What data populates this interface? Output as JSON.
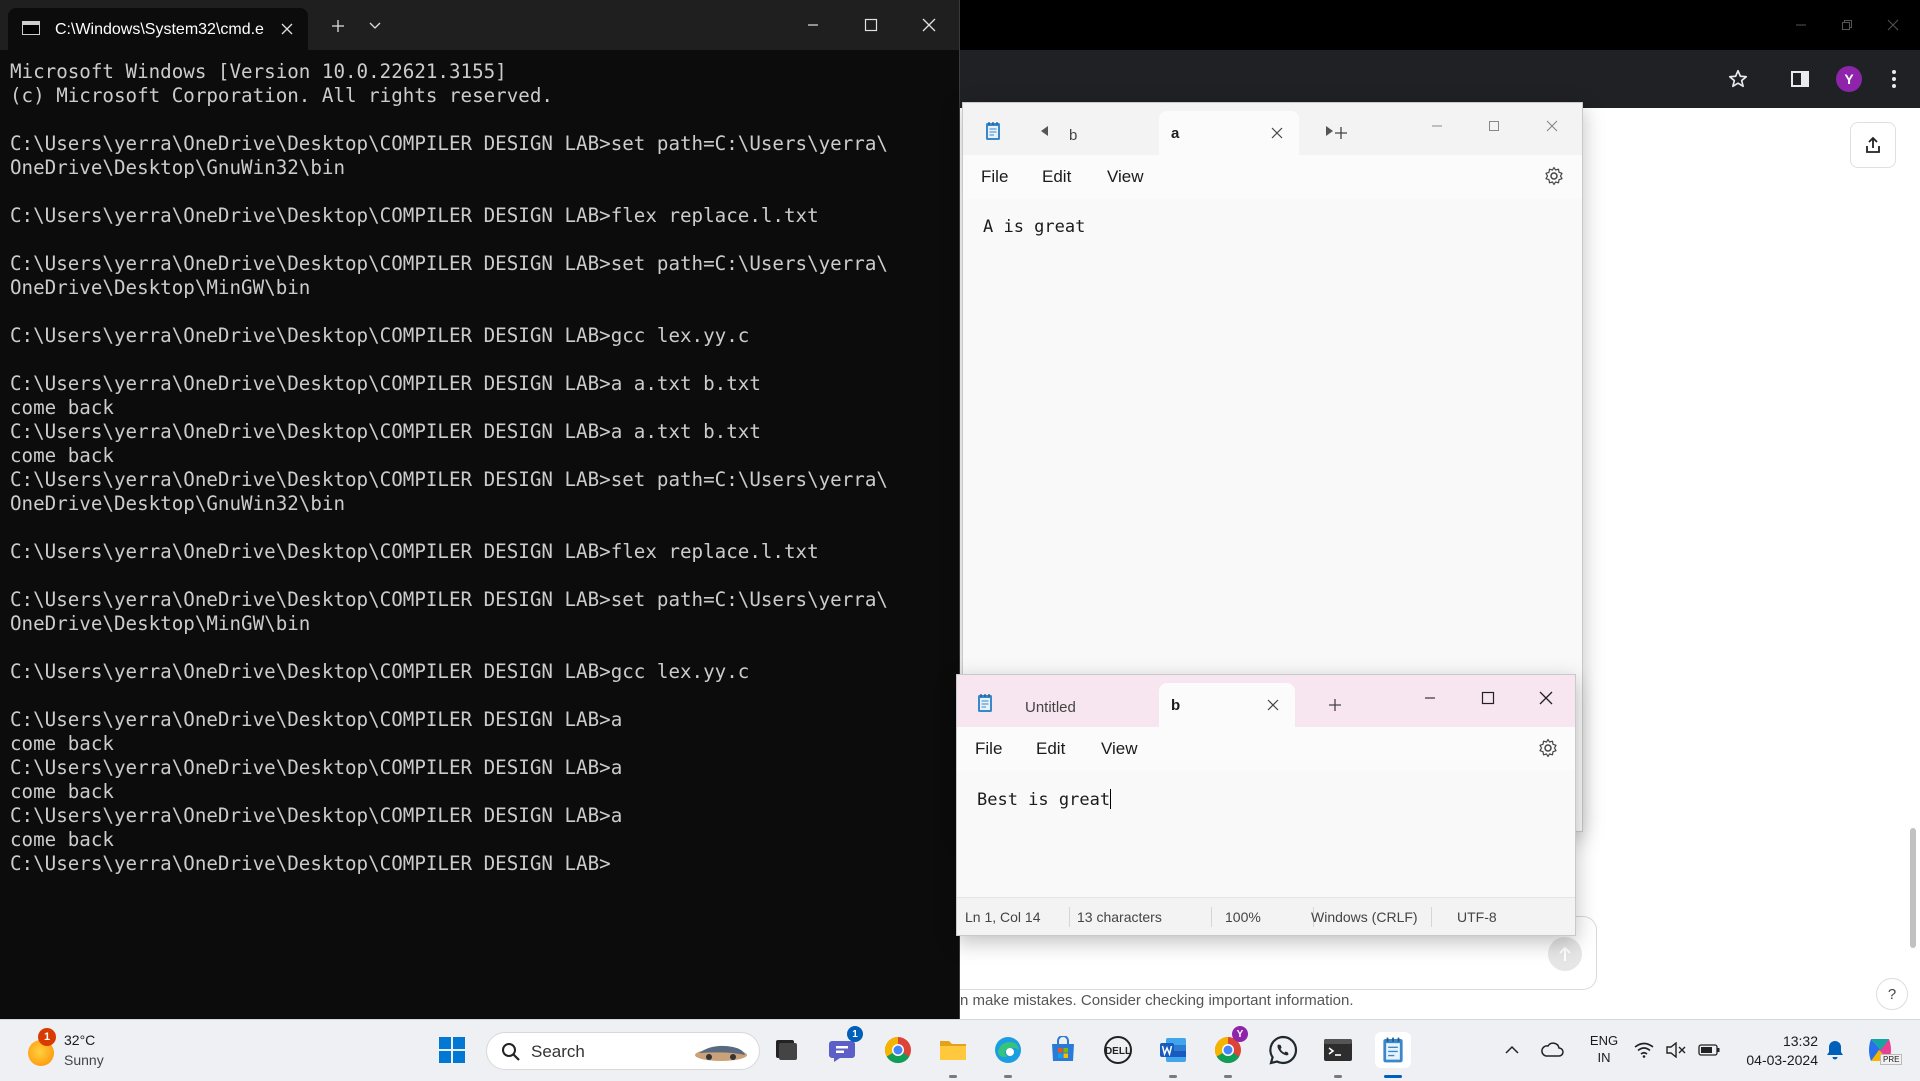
{
  "cmd": {
    "tab_title": "C:\\Windows\\System32\\cmd.e",
    "lines": [
      "Microsoft Windows [Version 10.0.22621.3155]",
      "(c) Microsoft Corporation. All rights reserved.",
      "",
      "C:\\Users\\yerra\\OneDrive\\Desktop\\COMPILER DESIGN LAB>set path=C:\\Users\\yerra\\",
      "OneDrive\\Desktop\\GnuWin32\\bin",
      "",
      "C:\\Users\\yerra\\OneDrive\\Desktop\\COMPILER DESIGN LAB>flex replace.l.txt",
      "",
      "C:\\Users\\yerra\\OneDrive\\Desktop\\COMPILER DESIGN LAB>set path=C:\\Users\\yerra\\",
      "OneDrive\\Desktop\\MinGW\\bin",
      "",
      "C:\\Users\\yerra\\OneDrive\\Desktop\\COMPILER DESIGN LAB>gcc lex.yy.c",
      "",
      "C:\\Users\\yerra\\OneDrive\\Desktop\\COMPILER DESIGN LAB>a a.txt b.txt",
      "come back",
      "C:\\Users\\yerra\\OneDrive\\Desktop\\COMPILER DESIGN LAB>a a.txt b.txt",
      "come back",
      "C:\\Users\\yerra\\OneDrive\\Desktop\\COMPILER DESIGN LAB>set path=C:\\Users\\yerra\\",
      "OneDrive\\Desktop\\GnuWin32\\bin",
      "",
      "C:\\Users\\yerra\\OneDrive\\Desktop\\COMPILER DESIGN LAB>flex replace.l.txt",
      "",
      "C:\\Users\\yerra\\OneDrive\\Desktop\\COMPILER DESIGN LAB>set path=C:\\Users\\yerra\\",
      "OneDrive\\Desktop\\MinGW\\bin",
      "",
      "C:\\Users\\yerra\\OneDrive\\Desktop\\COMPILER DESIGN LAB>gcc lex.yy.c",
      "",
      "C:\\Users\\yerra\\OneDrive\\Desktop\\COMPILER DESIGN LAB>a",
      "come back",
      "C:\\Users\\yerra\\OneDrive\\Desktop\\COMPILER DESIGN LAB>a",
      "come back",
      "C:\\Users\\yerra\\OneDrive\\Desktop\\COMPILER DESIGN LAB>a",
      "come back",
      "C:\\Users\\yerra\\OneDrive\\Desktop\\COMPILER DESIGN LAB>"
    ]
  },
  "notepad_a": {
    "tab_inactive": "b",
    "tab_active": "a",
    "menu": {
      "file": "File",
      "edit": "Edit",
      "view": "View"
    },
    "content": "A is great"
  },
  "notepad_b": {
    "tab_inactive": "Untitled",
    "tab_active": "b",
    "menu": {
      "file": "File",
      "edit": "Edit",
      "view": "View"
    },
    "content": "Best is great",
    "status": {
      "position": "Ln 1, Col 14",
      "characters": "13 characters",
      "zoom": "100%",
      "line_ending": "Windows (CRLF)",
      "encoding": "UTF-8"
    }
  },
  "browser": {
    "profile_initial": "Y",
    "disclaimer": "n make mistakes. Consider checking important information.",
    "help": "?"
  },
  "taskbar": {
    "weather": {
      "temp": "32°C",
      "condition": "Sunny",
      "badge": "1"
    },
    "search_placeholder": "Search",
    "teams_badge": "1",
    "chrome_profile_badge": "Y",
    "language": {
      "line1": "ENG",
      "line2": "IN"
    },
    "clock": {
      "time": "13:32",
      "date": "04-03-2024"
    },
    "copilot_badge": "PRE"
  },
  "colors": {
    "console_bg": "#0c0c0c",
    "console_text": "#cccccc",
    "notepad_b_titlebar": "#f7e6ef",
    "notepad_a_titlebar": "#f3f3f3",
    "taskbar_bg": "#eef0f4",
    "accent": "#005fb8"
  }
}
